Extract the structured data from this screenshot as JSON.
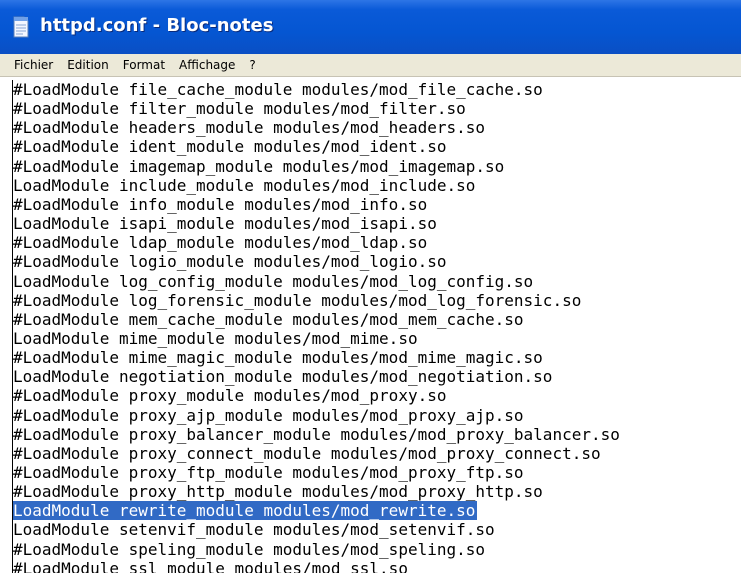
{
  "window": {
    "title": "httpd.conf - Bloc-notes"
  },
  "menu": {
    "items": [
      "Fichier",
      "Edition",
      "Format",
      "Affichage",
      "?"
    ]
  },
  "editor": {
    "selected_line_index": 23,
    "selection_color": "#316ac5",
    "lines": [
      "#LoadModule file_cache_module modules/mod_file_cache.so",
      "#LoadModule filter_module modules/mod_filter.so",
      "#LoadModule headers_module modules/mod_headers.so",
      "#LoadModule ident_module modules/mod_ident.so",
      "#LoadModule imagemap_module modules/mod_imagemap.so",
      "LoadModule include_module modules/mod_include.so",
      "#LoadModule info_module modules/mod_info.so",
      "LoadModule isapi_module modules/mod_isapi.so",
      "#LoadModule ldap_module modules/mod_ldap.so",
      "#LoadModule logio_module modules/mod_logio.so",
      "LoadModule log_config_module modules/mod_log_config.so",
      "#LoadModule log_forensic_module modules/mod_log_forensic.so",
      "#LoadModule mem_cache_module modules/mod_mem_cache.so",
      "LoadModule mime_module modules/mod_mime.so",
      "#LoadModule mime_magic_module modules/mod_mime_magic.so",
      "LoadModule negotiation_module modules/mod_negotiation.so",
      "#LoadModule proxy_module modules/mod_proxy.so",
      "#LoadModule proxy_ajp_module modules/mod_proxy_ajp.so",
      "#LoadModule proxy_balancer_module modules/mod_proxy_balancer.so",
      "#LoadModule proxy_connect_module modules/mod_proxy_connect.so",
      "#LoadModule proxy_ftp_module modules/mod_proxy_ftp.so",
      "#LoadModule proxy_http_module modules/mod_proxy_http.so",
      "LoadModule rewrite_module modules/mod_rewrite.so",
      "LoadModule setenvif_module modules/mod_setenvif.so",
      "#LoadModule speling_module modules/mod_speling.so",
      "#LoadModule ssl_module modules/mod_ssl.so"
    ]
  }
}
